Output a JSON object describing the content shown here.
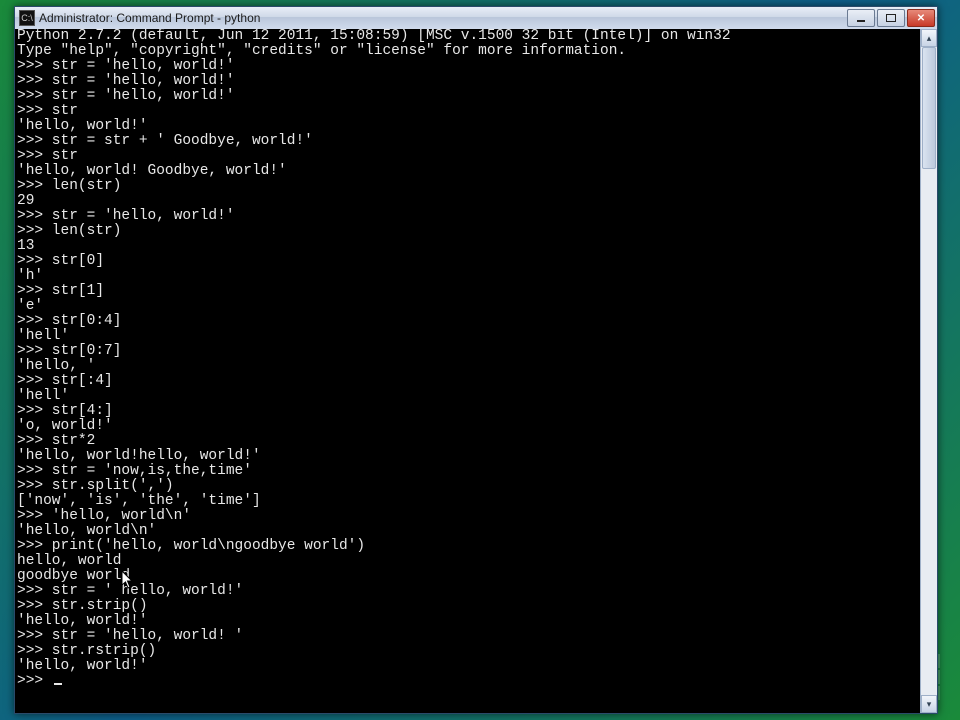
{
  "window": {
    "title": "Administrator: Command Prompt - python",
    "icon_label": "C:\\",
    "buttons": {
      "minimize": "minimize",
      "maximize": "maximize",
      "close": "close"
    }
  },
  "colors": {
    "titlebar_text": "#1a1a1a",
    "terminal_bg": "#000000",
    "terminal_fg": "#e8e8e8",
    "close_btn": "#c83a28"
  },
  "terminal": {
    "lines": [
      "Python 2.7.2 (default, Jun 12 2011, 15:08:59) [MSC v.1500 32 bit (Intel)] on win32",
      "Type \"help\", \"copyright\", \"credits\" or \"license\" for more information.",
      ">>> str = 'hello, world!'",
      ">>> str = 'hello, world!'",
      ">>> str = 'hello, world!'",
      ">>> str",
      "'hello, world!'",
      ">>> str = str + ' Goodbye, world!'",
      ">>> str",
      "'hello, world! Goodbye, world!'",
      ">>> len(str)",
      "29",
      ">>> str = 'hello, world!'",
      ">>> len(str)",
      "13",
      ">>> str[0]",
      "'h'",
      ">>> str[1]",
      "'e'",
      ">>> str[0:4]",
      "'hell'",
      ">>> str[0:7]",
      "'hello, '",
      ">>> str[:4]",
      "'hell'",
      ">>> str[4:]",
      "'o, world!'",
      ">>> str*2",
      "'hello, world!hello, world!'",
      ">>> str = 'now,is,the,time'",
      ">>> str.split(',')",
      "['now', 'is', 'the', 'time']",
      ">>> 'hello, world\\n'",
      "'hello, world\\n'",
      ">>> print('hello, world\\ngoodbye world')",
      "hello, world",
      "goodbye world",
      ">>> str = ' hello, world!'",
      ">>> str.strip()",
      "'hello, world!'",
      ">>> str = 'hello, world! '",
      ">>> str.rstrip()",
      "'hello, world!'",
      ">>> "
    ]
  },
  "scrollbar": {
    "up_glyph": "▴",
    "down_glyph": "▾"
  }
}
